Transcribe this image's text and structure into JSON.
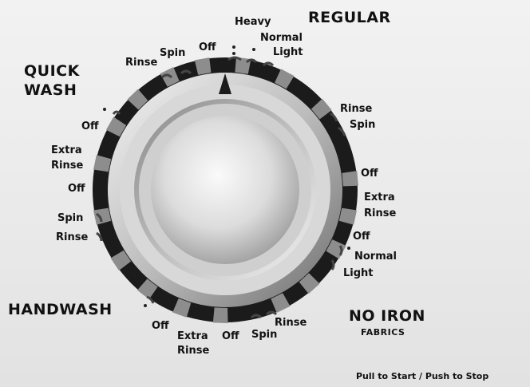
{
  "cycles": {
    "regular": "REGULAR",
    "quick_wash_line1": "QUICK",
    "quick_wash_line2": "WASH",
    "handwash": "HANDWASH",
    "no_iron": "NO IRON",
    "no_iron_sub": "FABRICS"
  },
  "settings": {
    "heavy": "Heavy",
    "normal": "Normal",
    "light": "Light",
    "off": "Off",
    "spin": "Spin",
    "rinse": "Rinse",
    "extra": "Extra"
  },
  "footer": "Pull to Start / Push to Stop",
  "colors": {
    "panel": "#ececec",
    "ring": "#1b1b1b",
    "knob": "#cfcfcf",
    "text": "#111111"
  }
}
